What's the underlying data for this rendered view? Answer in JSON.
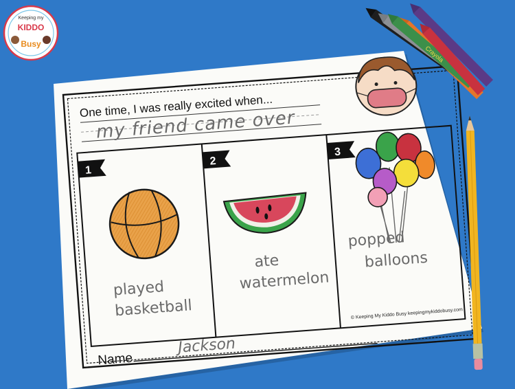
{
  "logo": {
    "line1": "Keeping my",
    "line2": "KIDDO",
    "line3": "Busy"
  },
  "worksheet": {
    "prompt": "One time, I was really excited when...",
    "answer": "my friend came over",
    "panels": [
      {
        "number": "1",
        "caption_line1": "played",
        "caption_line2": "basketball",
        "drawing": "basketball-drawing"
      },
      {
        "number": "2",
        "caption_line1": "ate",
        "caption_line2": "watermelon",
        "drawing": "watermelon-drawing"
      },
      {
        "number": "3",
        "caption_line1": "popped",
        "caption_line2": "balloons",
        "drawing": "balloons-drawing"
      }
    ],
    "copyright": "© Keeping My Kiddo Busy keepingmykiddobusy.com",
    "name_label": "Name",
    "name_value": "Jackson"
  },
  "props": {
    "crayon_brand": "Crayola"
  }
}
